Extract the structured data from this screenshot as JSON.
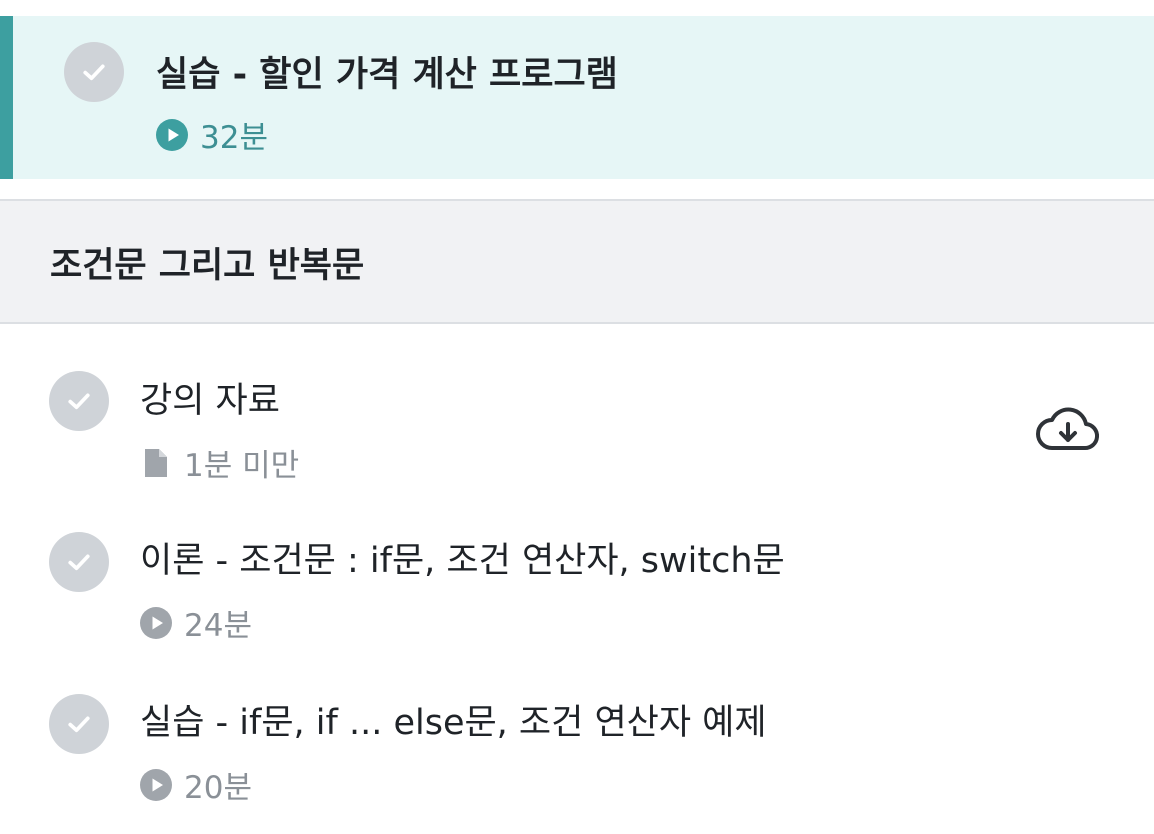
{
  "active_lesson": {
    "title": "실습 - 할인 가격 계산 프로그램",
    "duration": "32분",
    "type_icon": "play-circle-icon",
    "accent_color": "#3d9fa0",
    "background_color": "#e6f6f6"
  },
  "section": {
    "title": "조건문 그리고 반복문"
  },
  "lessons": [
    {
      "title": "강의 자료",
      "meta": "1분 미만",
      "type_icon": "document-icon",
      "action_icon": "cloud-download-icon"
    },
    {
      "title": "이론 - 조건문 : if문, 조건 연산자, switch문",
      "meta": "24분",
      "type_icon": "play-circle-icon"
    },
    {
      "title": "실습 - if문, if ... else문, 조건 연산자 예제",
      "meta": "20분",
      "type_icon": "play-circle-icon"
    }
  ]
}
